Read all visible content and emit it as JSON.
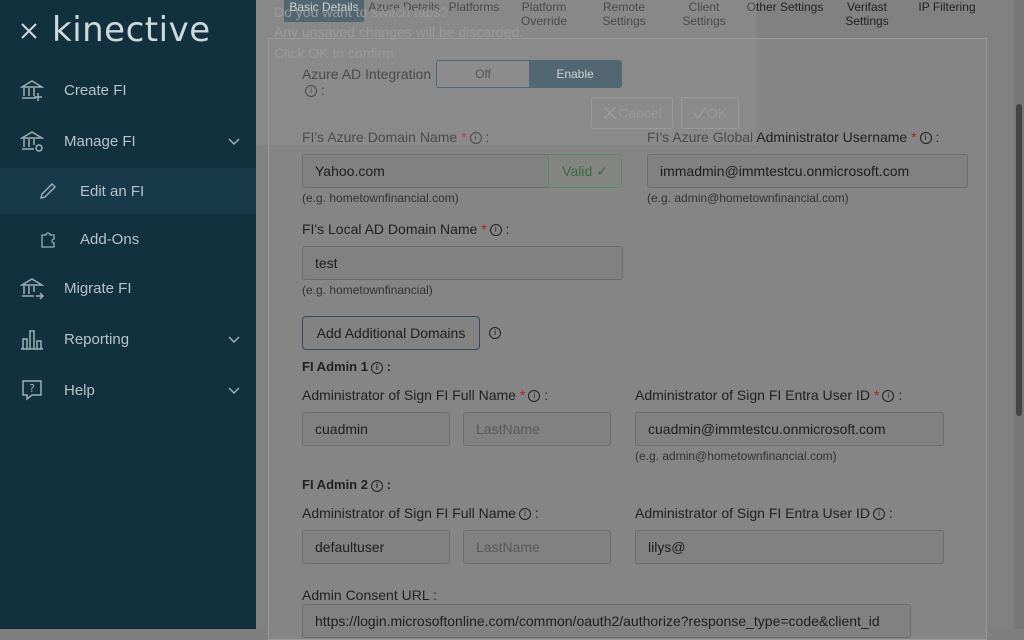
{
  "sidebar": {
    "logo": "kinective",
    "items": [
      {
        "label": "Create FI",
        "icon": "bank-plus-icon"
      },
      {
        "label": "Manage FI",
        "icon": "bank-gear-icon"
      },
      {
        "label": "Edit an FI",
        "icon": "pencil-icon"
      },
      {
        "label": "Add-Ons",
        "icon": "puzzle-icon"
      },
      {
        "label": "Migrate FI",
        "icon": "bank-arrow-icon"
      },
      {
        "label": "Reporting",
        "icon": "bar-chart-icon"
      },
      {
        "label": "Help",
        "icon": "question-bubble-icon"
      }
    ]
  },
  "tabs": [
    {
      "label": "Basic Details"
    },
    {
      "label": "Azure Details"
    },
    {
      "label": "Platforms"
    },
    {
      "label": "Platform Override"
    },
    {
      "label": "Remote Settings"
    },
    {
      "label": "Client Settings"
    },
    {
      "label": "Other Settings"
    },
    {
      "label": "Verifast Settings"
    },
    {
      "label": "IP Filtering"
    }
  ],
  "dialog": {
    "line1": "Do you want to switch tabs?",
    "line2": "Any unsaved changes will be discarded.",
    "line3": "Click OK to confirm",
    "cancel": "Cancel",
    "ok": "OK"
  },
  "form": {
    "azure_ad_label": "Azure AD Integration",
    "azure_ad_colon": ":",
    "toggle_off": "Off",
    "toggle_on": "Enable",
    "azure_domain_label": "FI's Azure Domain Name",
    "azure_domain_value": "Yahoo.com",
    "valid_label": "Valid ✓",
    "azure_domain_hint": "(e.g. hometownfinancial.com)",
    "global_admin_label": "FI's Azure Global Administrator Username",
    "global_admin_value": "immadmin@immtestcu.onmicrosoft.com",
    "global_admin_hint": "(e.g. admin@hometownfinancial.com)",
    "local_ad_label": "FI's Local AD Domain Name",
    "local_ad_value": "test",
    "local_ad_hint": "(e.g. hometownfinancial)",
    "add_domains_button": "Add Additional Domains",
    "admin1_title": "FI Admin 1",
    "admin1_fullname_label": "Administrator of Sign FI Full Name",
    "admin1_first": "cuadmin",
    "admin1_last_placeholder": "LastName",
    "admin1_entra_label": "Administrator of Sign FI Entra User ID",
    "admin1_entra_value": "cuadmin@immtestcu.onmicrosoft.com",
    "admin1_entra_hint": "(e.g. admin@hometownfinancial.com)",
    "admin2_title": "FI Admin 2",
    "admin2_fullname_label": "Administrator of Sign FI Full Name",
    "admin2_first": "defaultuser",
    "admin2_last_placeholder": "LastName",
    "admin2_entra_label": "Administrator of Sign FI Entra User ID",
    "admin2_entra_value": "lilys@",
    "consent_label": "Admin Consent URL :",
    "consent_value": "https://login.microsoftonline.com/common/oauth2/authorize?response_type=code&client_id"
  },
  "colors": {
    "sidebar_bg": "#12313f",
    "accent": "#2f4f5e",
    "required": "#a3242b",
    "valid": "#3d6b44"
  }
}
